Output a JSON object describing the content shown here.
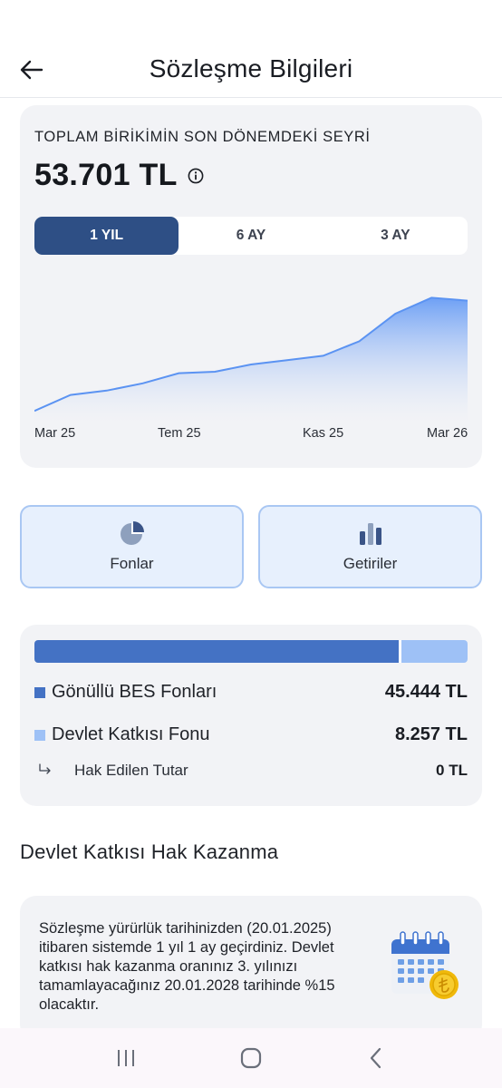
{
  "header": {
    "title": "Sözleşme Bilgileri"
  },
  "summary": {
    "caption": "TOPLAM BİRİKİMİN SON DÖNEMDEKİ SEYRİ",
    "total": "53.701 TL"
  },
  "periods": [
    {
      "label": "1 YIL",
      "active": true
    },
    {
      "label": "6 AY",
      "active": false
    },
    {
      "label": "3 AY",
      "active": false
    }
  ],
  "chart_data": {
    "type": "area",
    "x_tick_labels": [
      "Mar 25",
      "Tem 25",
      "Kas 25",
      "Mar 26"
    ],
    "values": [
      8,
      19,
      22,
      27,
      34,
      35,
      40,
      43,
      46,
      56,
      75,
      86,
      84
    ],
    "ylim": [
      0,
      100
    ],
    "grid": false,
    "colors": {
      "line": "#5b93f2",
      "fill_top": "#6ea0f5",
      "fill_bottom": "#f2f3f6"
    }
  },
  "actions": {
    "funds_label": "Fonlar",
    "returns_label": "Getiriler"
  },
  "funds": {
    "voluntary": {
      "label": "Gönüllü BES Fonları",
      "value": "45.444 TL",
      "share": 0.846,
      "color": "#4472c4"
    },
    "state": {
      "label": "Devlet Katkısı Fonu",
      "value": "8.257 TL",
      "share": 0.154,
      "color": "#9ec1f6"
    },
    "vested": {
      "label": "Hak Edilen Tutar",
      "value": "0 TL"
    }
  },
  "section": {
    "title": "Devlet Katkısı Hak Kazanma"
  },
  "info": {
    "text": "Sözleşme yürürlük tarihinizden (20.01.2025) itibaren sistemde 1 yıl 1 ay geçirdiniz. Devlet katkısı hak kazanma oranınız 3. yılınızı tamamlayacağınız 20.01.2028 tarihinde %15 olacaktır."
  },
  "icons": {
    "back": "arrow-left-icon",
    "info": "info-circle-icon",
    "funds": "pie-chart-icon",
    "returns": "bar-chart-icon",
    "calendar": "calendar-coin-icon",
    "nav": [
      "recent-apps-icon",
      "home-icon",
      "back-nav-icon"
    ]
  }
}
